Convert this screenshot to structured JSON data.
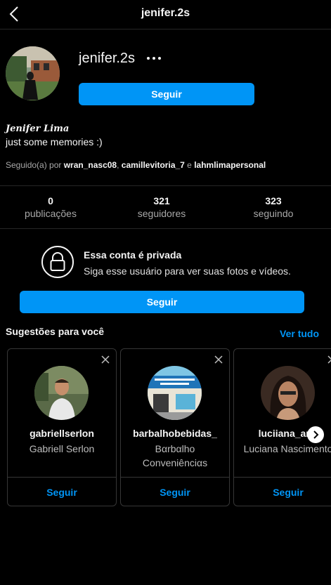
{
  "header": {
    "title": "jenifer.2s"
  },
  "profile": {
    "username": "jenifer.2s",
    "follow_label": "Seguir",
    "full_name": "𝑱𝒆𝒏𝒊𝒇𝒆𝒓 𝑳𝒊𝒎𝒂",
    "bio": "just some memories :)",
    "followed_by_prefix": "Seguido(a) por ",
    "followed_by": [
      "wran_nasc08",
      "camillevitoria_7",
      "lahmlimapersonal"
    ],
    "followed_by_sep": ", ",
    "followed_by_and": " e "
  },
  "stats": [
    {
      "value": "0",
      "label": "publicações"
    },
    {
      "value": "321",
      "label": "seguidores"
    },
    {
      "value": "323",
      "label": "seguindo"
    }
  ],
  "private": {
    "title": "Essa conta é privada",
    "subtitle": "Siga esse usuário para ver suas fotos e vídeos.",
    "follow_label": "Seguir"
  },
  "suggestions": {
    "title": "Sugestões para você",
    "see_all": "Ver tudo",
    "cards": [
      {
        "username": "gabriellserlon",
        "name": "Gabriell Serlon",
        "follow": "Seguir"
      },
      {
        "username": "barbalhobebidas_",
        "name": "Bαrbαlho\nConveniênciαs",
        "follow": "Seguir"
      },
      {
        "username": "luciiana_ang",
        "name": "Luciana Nascimento",
        "follow": "Seguir"
      }
    ]
  },
  "colors": {
    "accent": "#0095f6",
    "background": "#000000",
    "border": "#262626"
  }
}
